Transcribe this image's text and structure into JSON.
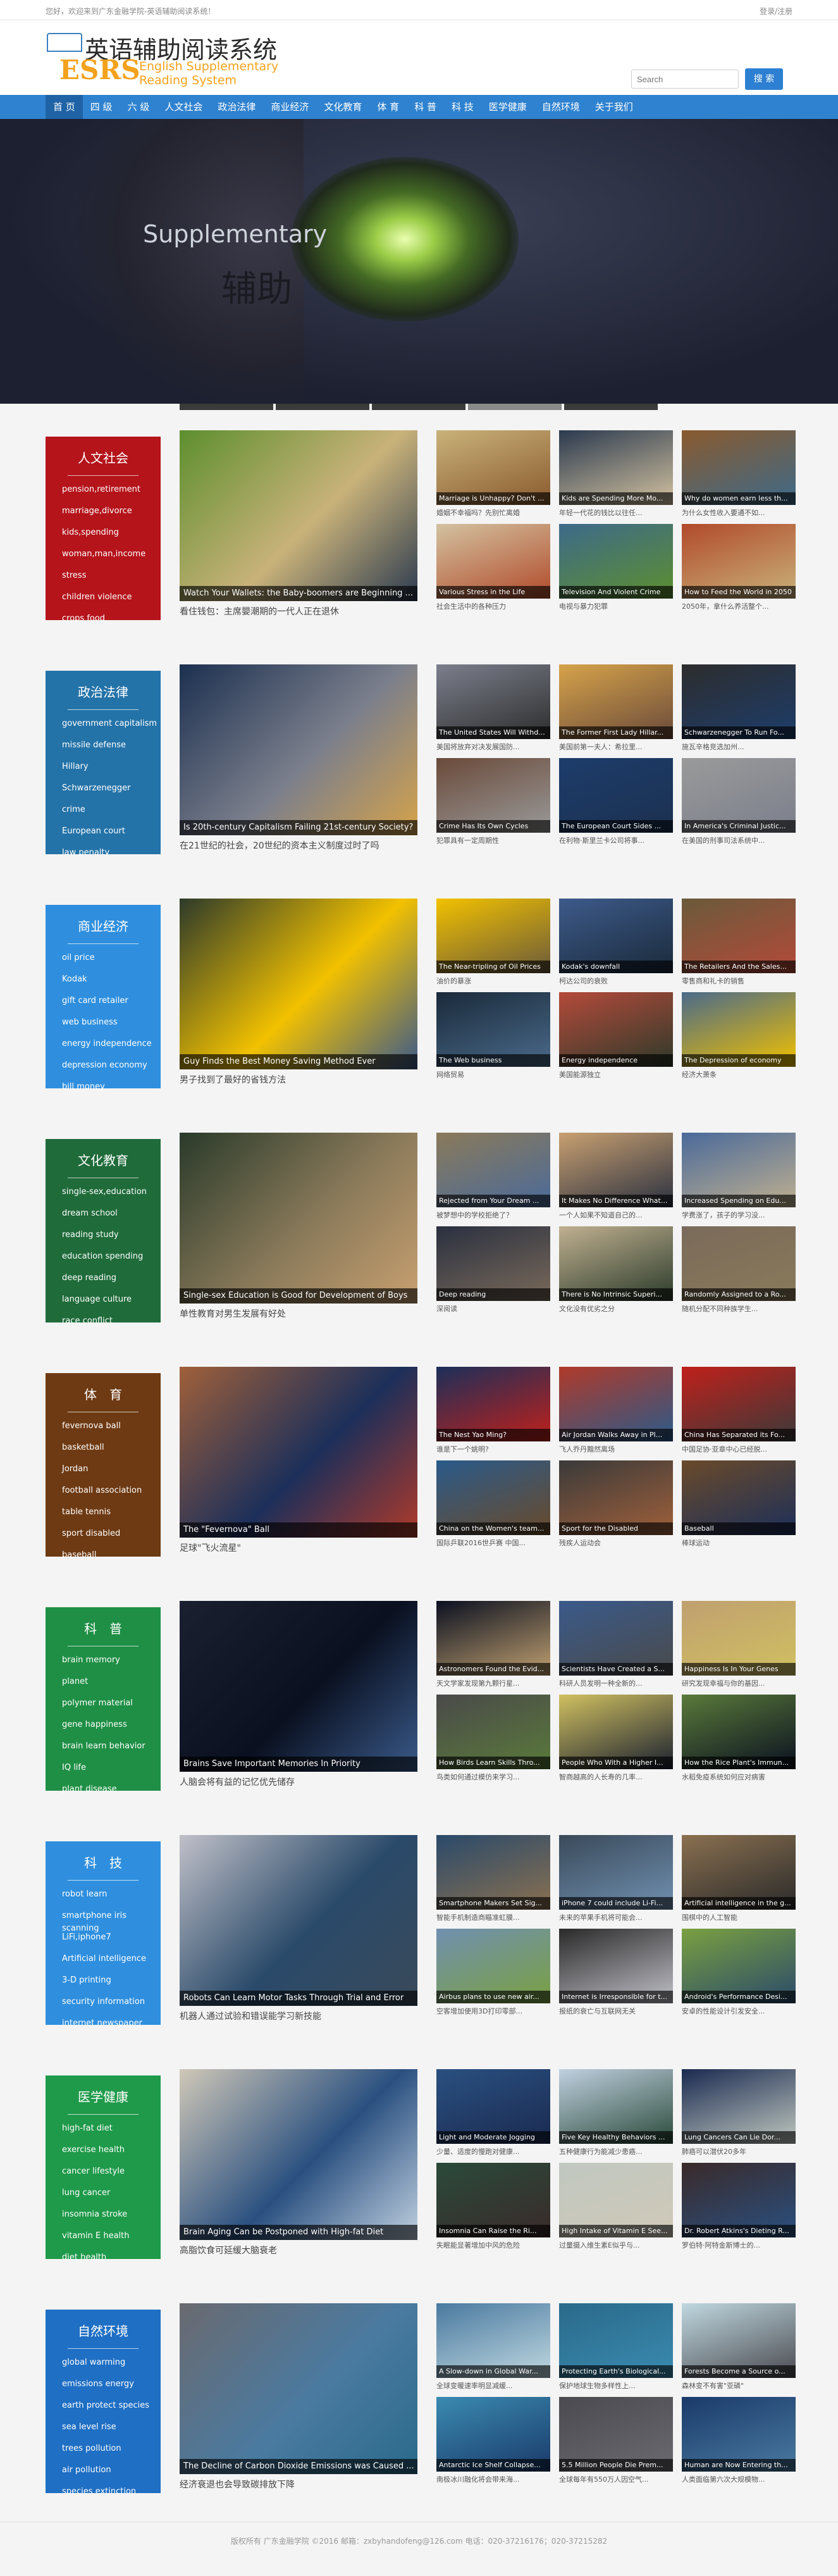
{
  "topbar": {
    "left": "您好，欢迎来到广东金融学院-英语辅助阅读系统！",
    "right": "登录/注册"
  },
  "logo": {
    "cn": "英语辅助阅读系统",
    "esrs": "ESRS",
    "en1": "English Supplementary",
    "en2": "Reading System"
  },
  "search": {
    "placeholder": "Search",
    "button": "搜 索"
  },
  "nav": [
    "首 页",
    "四 级",
    "六 级",
    "人文社会",
    "政治法律",
    "商业经济",
    "文化教育",
    "体 育",
    "科 普",
    "科 技",
    "医学健康",
    "自然环境",
    "关于我们"
  ],
  "banner": {
    "text1": "Supplementary",
    "text2": "辅助"
  },
  "colors": {
    "nav": "#2f82cf",
    "accent": "#f4a21c"
  },
  "sections": [
    {
      "title": "人文社会",
      "color": "#b5141b",
      "items": [
        "pension,retirement",
        "marriage,divorce",
        "kids,spending",
        "woman,man,income",
        "stress",
        "children violence",
        "crops food"
      ],
      "big": {
        "cap": "Watch Your Wallets: the Baby-boomers are Beginning ...",
        "sub": "看住钱包：主席嬰潮期的一代人正在退休"
      },
      "thumbs": [
        {
          "cap": "Marriage is Unhappy? Don't ...",
          "sub": "婚姻不幸福吗？先别忙离婚"
        },
        {
          "cap": "Kids are Spending More Mo...",
          "sub": "年轻一代花的钱比以往任..."
        },
        {
          "cap": "Why do women earn less th...",
          "sub": "为什么女性收入要通不如..."
        },
        {
          "cap": "Various Stress in the Life",
          "sub": "社会生活中的各种压力"
        },
        {
          "cap": "Television And Violent Crime",
          "sub": "电视与暴力犯罪"
        },
        {
          "cap": "How to Feed the World in 2050",
          "sub": "2050年，拿什么养活整个..."
        }
      ]
    },
    {
      "title": "政治法律",
      "color": "#2473a8",
      "items": [
        "government capitalism",
        "missile defense",
        "Hillary",
        "Schwarzenegger",
        "crime",
        "European court",
        "law penalty"
      ],
      "big": {
        "cap": "Is 20th-century Capitalism Failing 21st-century Society?",
        "sub": "在21世纪的社会，20世纪的资本主义制度过时了吗"
      },
      "thumbs": [
        {
          "cap": "The United States Will Withd...",
          "sub": "美国将放弃对决发展国防..."
        },
        {
          "cap": "The Former First Lady Hillar...",
          "sub": "美国前第一夫人：希拉里..."
        },
        {
          "cap": "Schwarzenegger To Run Fo...",
          "sub": "施瓦辛格竞选加州..."
        },
        {
          "cap": "Crime Has Its Own Cycles",
          "sub": "犯罪具有一定周期性"
        },
        {
          "cap": "The European Court Sides ...",
          "sub": "在利物·斯里兰卡公司将事..."
        },
        {
          "cap": "In America's Criminal Justic...",
          "sub": "在美国的刑事司法系统中..."
        }
      ]
    },
    {
      "title": "商业经济",
      "color": "#2f8fde",
      "items": [
        "oil price",
        "Kodak",
        "gift card retailer",
        "web business",
        "energy independence",
        "depression economy",
        "bill money"
      ],
      "big": {
        "cap": "Guy Finds the Best Money Saving Method Ever",
        "sub": "男子找到了最好的省钱方法"
      },
      "thumbs": [
        {
          "cap": "The Near-tripling of Oil Prices",
          "sub": "油价的暴涨"
        },
        {
          "cap": "Kodak's downfall",
          "sub": "柯达公司的衰败"
        },
        {
          "cap": "The Retailers And the Sales...",
          "sub": "零售商和礼卡的销售"
        },
        {
          "cap": "The Web business",
          "sub": "网络贸易"
        },
        {
          "cap": "Energy independence",
          "sub": "美国能源独立"
        },
        {
          "cap": "The Depression of economy",
          "sub": "经济大萧条"
        }
      ]
    },
    {
      "title": "文化教育",
      "color": "#1f6b3a",
      "items": [
        "single-sex,education",
        "dream school",
        "reading study",
        "education spending",
        "deep reading",
        "language culture",
        "race conflict"
      ],
      "big": {
        "cap": "Single-sex Education is Good for Development of Boys",
        "sub": "单性教育对男生发展有好处"
      },
      "thumbs": [
        {
          "cap": "Rejected from Your Dream ...",
          "sub": "被梦想中的学校拒绝了？"
        },
        {
          "cap": "It Makes No Difference What...",
          "sub": "一个人如果不知道自己的..."
        },
        {
          "cap": "Increased Spending on Edu...",
          "sub": "学费涨了，孩子的学习没..."
        },
        {
          "cap": "Deep reading",
          "sub": "深阅读"
        },
        {
          "cap": "There is No Intrinsic Superi...",
          "sub": "文化没有优劣之分"
        },
        {
          "cap": "Randomly Assigned to a Ro...",
          "sub": "随机分配不同种族学生..."
        }
      ]
    },
    {
      "title": "体　育",
      "color": "#6e3a13",
      "items": [
        "fevernova ball",
        "basketball",
        "Jordan",
        "football association",
        "table tennis",
        "sport disabled",
        "baseball"
      ],
      "big": {
        "cap": "The \"Fevernova\" Ball",
        "sub": "足球\"飞火流星\""
      },
      "thumbs": [
        {
          "cap": "The Nest Yao Ming?",
          "sub": "谁是下一个姚明?"
        },
        {
          "cap": "Air Jordan Walks Away in Pl...",
          "sub": "飞人乔丹黯然离场"
        },
        {
          "cap": "China Has Separated its Fo...",
          "sub": "中国足协·亚章中心已经脱..."
        },
        {
          "cap": "China on the Women's team...",
          "sub": "国际乒联2016世乒赛 中国..."
        },
        {
          "cap": "Sport for the Disabled",
          "sub": "残疾人运动会"
        },
        {
          "cap": "Baseball",
          "sub": "棒球运动"
        }
      ]
    },
    {
      "title": "科　普",
      "color": "#1f8f45",
      "items": [
        "brain memory",
        "planet",
        "polymer material",
        "gene happiness",
        "brain learn behavior",
        "IQ life",
        "plant disease"
      ],
      "big": {
        "cap": "Brains Save Important Memories In Priority",
        "sub": "人脑会将有益的记忆优先储存"
      },
      "thumbs": [
        {
          "cap": "Astronomers Found the Evid...",
          "sub": "天文学家发现第九颗行星..."
        },
        {
          "cap": "Scientists Have Created a S...",
          "sub": "科研人员发明一种全新的..."
        },
        {
          "cap": "Happiness Is In Your Genes",
          "sub": "研究发现幸福与你的基因..."
        },
        {
          "cap": "How Birds Learn Skills Thro...",
          "sub": "鸟类如何通过模仿来学习..."
        },
        {
          "cap": "People Who With a Higher I...",
          "sub": "智商越高的人长寿的几率..."
        },
        {
          "cap": "How the Rice Plant's Immun...",
          "sub": "水稻免疫系统如何应对病害"
        }
      ]
    },
    {
      "title": "科　技",
      "color": "#2f8fde",
      "items": [
        "robot learn",
        "smartphone iris scanning",
        "LiFi,iphone7",
        "Artificial intelligence",
        "3-D printing",
        "security information",
        "internet newspaper"
      ],
      "big": {
        "cap": "Robots Can Learn Motor Tasks Through Trial and Error",
        "sub": "机器人通过试验和错误能学习新技能"
      },
      "thumbs": [
        {
          "cap": "Smartphone Makers Set Sig...",
          "sub": "智能手机制造商瞄准虹膜..."
        },
        {
          "cap": "iPhone 7 could include Li-Fi...",
          "sub": "未来的苹果手机将可能会..."
        },
        {
          "cap": "Artificial intelligence in the g...",
          "sub": "围棋中的人工智能"
        },
        {
          "cap": "Airbus plans to use new air...",
          "sub": "空客增加使用3D打印零部..."
        },
        {
          "cap": "Internet is Irresponsible for t...",
          "sub": "报纸的衰亡与互联网无关"
        },
        {
          "cap": "Android's Performance Desi...",
          "sub": "安卓的性能设计引发安全..."
        }
      ]
    },
    {
      "title": "医学健康",
      "color": "#1f9a4a",
      "items": [
        "high-fat diet",
        "exercise health",
        "cancer lifestyle",
        "lung cancer",
        "insomnia stroke",
        "vitamin E health",
        "diet health"
      ],
      "big": {
        "cap": "Brain Aging Can be Postponed with High-fat Diet",
        "sub": "高脂饮食可延缓大脑衰老"
      },
      "thumbs": [
        {
          "cap": "Light and Moderate Jogging",
          "sub": "少量、适度的慢跑对健康..."
        },
        {
          "cap": "Five Key Healthy Behaviors ...",
          "sub": "五种健康行为能减少患癌..."
        },
        {
          "cap": "Lung Cancers Can Lie Dor...",
          "sub": "肺癌可以潜伏20多年"
        },
        {
          "cap": "Insomnia Can Raise the Ri...",
          "sub": "失眠能显著增加中风的危险"
        },
        {
          "cap": "High Intake of Vitamin E See...",
          "sub": "过量摄入维生素E似乎与..."
        },
        {
          "cap": "Dr. Robert Atkins's Dieting R...",
          "sub": "罗伯特·阿特金斯博士的..."
        }
      ]
    },
    {
      "title": "自然环境",
      "color": "#1f6fc4",
      "items": [
        "global warming",
        "emissions energy",
        "earth protect species",
        "sea level rise",
        "trees pollution",
        "air pollution",
        "species extinction"
      ],
      "big": {
        "cap": "The Decline of Carbon Dioxide Emissions was Caused ...",
        "sub": "经济衰退也会导致碳排放下降"
      },
      "thumbs": [
        {
          "cap": "A Slow-down in Global War...",
          "sub": "全球变暖速率明显减缓..."
        },
        {
          "cap": "Protecting Earth's Biological...",
          "sub": "保护地球生物多样性上..."
        },
        {
          "cap": "Forests Become a Source o...",
          "sub": "森林变不有害\"亚磷\""
        },
        {
          "cap": "Antarctic Ice Shelf Collapse...",
          "sub": "南极冰川融化将会带来海..."
        },
        {
          "cap": "5.5 Million People Die Prem...",
          "sub": "全球每年有550万人因空气..."
        },
        {
          "cap": "Human are Now Entering th...",
          "sub": "人类面临第六次大规模物..."
        }
      ]
    }
  ],
  "footer": "版权所有 广东金融学院 ©2016 邮箱：zxbyhandofeng@126.com 电话：020-37216176；020-37215282"
}
